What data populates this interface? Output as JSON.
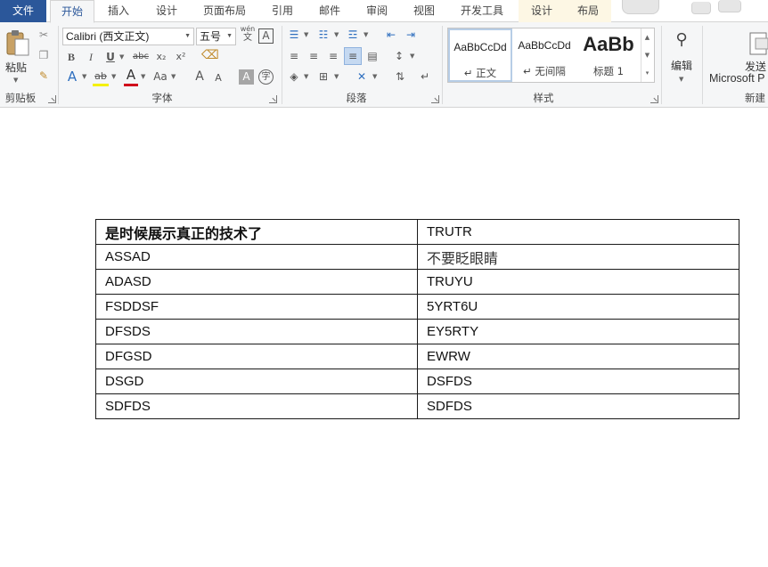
{
  "tabs": {
    "file": "文件",
    "home": "开始",
    "insert": "插入",
    "design": "设计",
    "layout": "页面布局",
    "references": "引用",
    "mailings": "邮件",
    "review": "审阅",
    "view": "视图",
    "developer": "开发工具",
    "table_design": "设计",
    "table_layout": "布局"
  },
  "clipboard": {
    "paste_label": "粘贴",
    "group_label": "剪贴板"
  },
  "font": {
    "font_name": "Calibri (西文正文)",
    "font_size": "五号",
    "group_label": "字体",
    "wen_glyph": "wén",
    "wen_sub": "文",
    "border_char_glyph": "A",
    "bold_glyph": "B",
    "italic_glyph": "I",
    "underline_glyph": "U",
    "strike_glyph": "abc",
    "subscript_glyph": "x₂",
    "superscript_glyph": "x²",
    "effects_glyph": "A",
    "highlight_glyph": "ab",
    "color_glyph": "A",
    "case_glyph": "Aa",
    "grow_glyph": "A",
    "shrink_glyph": "A",
    "shade_glyph": "A",
    "encircle_glyph": "字"
  },
  "paragraph": {
    "group_label": "段落"
  },
  "styles": {
    "group_label": "样式",
    "items": [
      {
        "sample": "AaBbCcDd",
        "name": "↵ 正文"
      },
      {
        "sample": "AaBbCcDd",
        "name": "↵ 无间隔"
      },
      {
        "sample": "AaBb",
        "name": "标题 1"
      }
    ]
  },
  "editing": {
    "label": "编辑"
  },
  "send": {
    "label_line1": "发送",
    "label_line2": "Microsoft P",
    "group_label": "新建"
  },
  "table": {
    "rows": [
      [
        "是时候展示真正的技术了",
        "TRUTR"
      ],
      [
        "ASSAD",
        "不要眨眼睛"
      ],
      [
        "ADASD",
        "TRUYU"
      ],
      [
        "FSDDSF",
        "5YRT6U"
      ],
      [
        "DFSDS",
        "EY5RTY"
      ],
      [
        "DFGSD",
        "EWRW"
      ],
      [
        "DSGD",
        "DSFDS"
      ],
      [
        "SDFDS",
        "SDFDS"
      ]
    ]
  },
  "colors": {
    "file_tab": "#2b579a",
    "ribbon_bg": "#f5f6f7",
    "font_color_bar": "#d0021b",
    "highlight_bar": "#f4f000",
    "context_tab_bg": "#fdf7e4"
  }
}
